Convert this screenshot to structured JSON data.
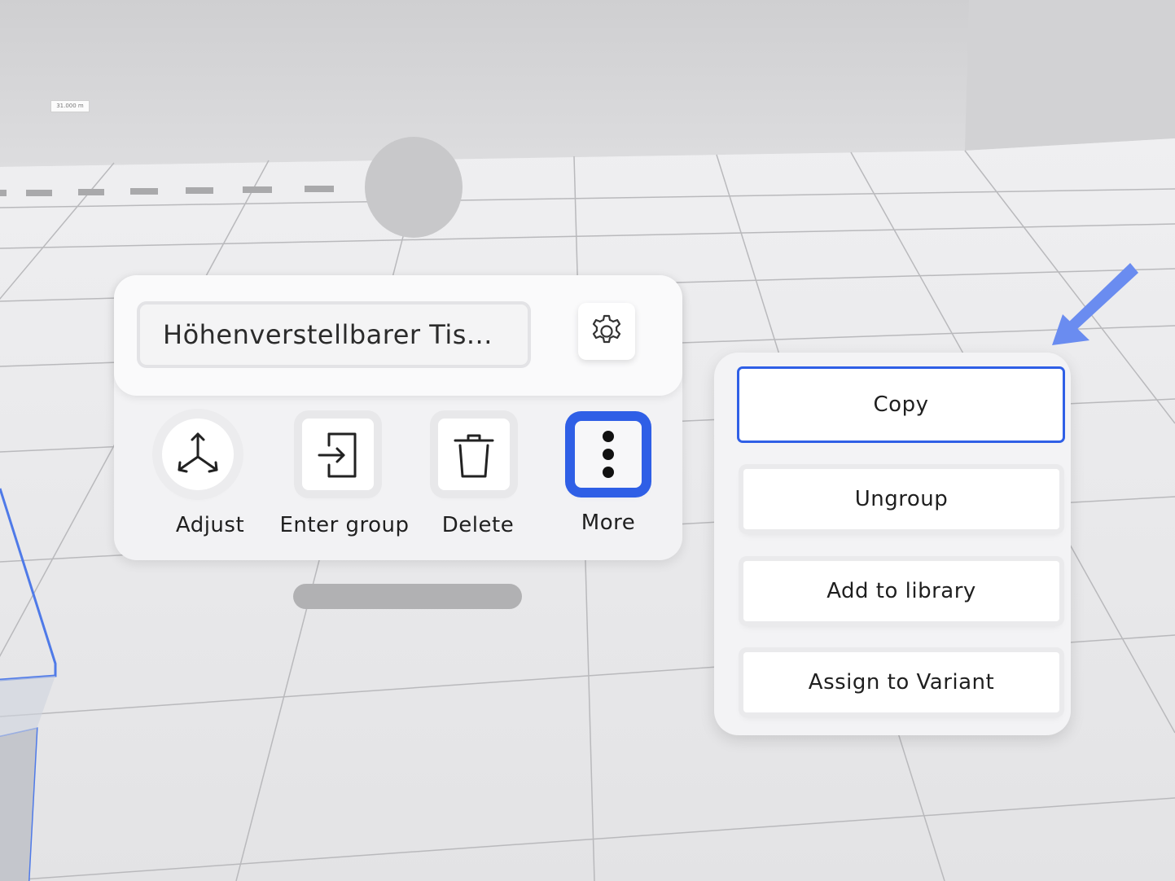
{
  "scene": {
    "dimension_label": "31.000 m"
  },
  "object_panel": {
    "object_name": "Höhenverstellbarer Tis...",
    "settings_icon": "gear-icon",
    "tools": [
      {
        "label": "Adjust",
        "icon": "axes-move-icon"
      },
      {
        "label": "Enter group",
        "icon": "enter-group-icon"
      },
      {
        "label": "Delete",
        "icon": "trash-icon"
      },
      {
        "label": "More",
        "icon": "more-vertical-icon"
      }
    ]
  },
  "more_menu": {
    "items": [
      {
        "label": "Copy",
        "selected": true
      },
      {
        "label": "Ungroup",
        "selected": false
      },
      {
        "label": "Add to library",
        "selected": false
      },
      {
        "label": "Assign to Variant",
        "selected": false
      }
    ]
  },
  "colors": {
    "accent": "#2f5fe6",
    "pointer_arrow": "#6a8cf0"
  }
}
